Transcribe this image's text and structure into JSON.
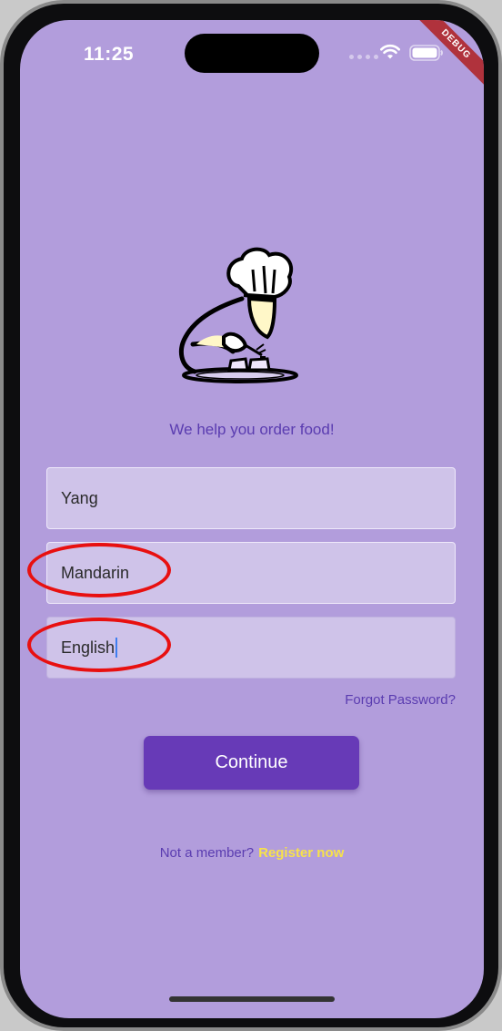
{
  "status_bar": {
    "time": "11:25",
    "wifi_icon": "wifi-icon",
    "battery_icon": "battery-icon"
  },
  "debug_banner": "DEBUG",
  "logo_icon": "chef-plating-food-icon",
  "tagline": "We help you order food!",
  "form": {
    "fields": [
      {
        "value": "Yang"
      },
      {
        "value": "Mandarin"
      },
      {
        "value": "English"
      }
    ],
    "forgot_password": "Forgot Password?",
    "continue_label": "Continue"
  },
  "footer": {
    "prompt": "Not a member?",
    "register_link": "Register now"
  },
  "colors": {
    "background": "#b29ddc",
    "primary": "#673ab7",
    "link_accent": "#f7e24a",
    "annotation": "#e81010"
  }
}
